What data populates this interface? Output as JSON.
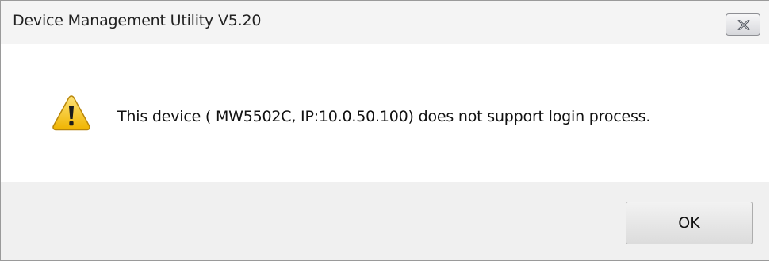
{
  "window": {
    "title": "Device Management Utility V5.20"
  },
  "dialog": {
    "icon": "warning-icon",
    "message": "This device ( MW5502C, IP:10.0.50.100) does not support login process.",
    "ok_label": "OK"
  },
  "colors": {
    "dialog_background": "#f0f0f0",
    "content_background": "#ffffff",
    "warning_yellow": "#f7c623"
  }
}
